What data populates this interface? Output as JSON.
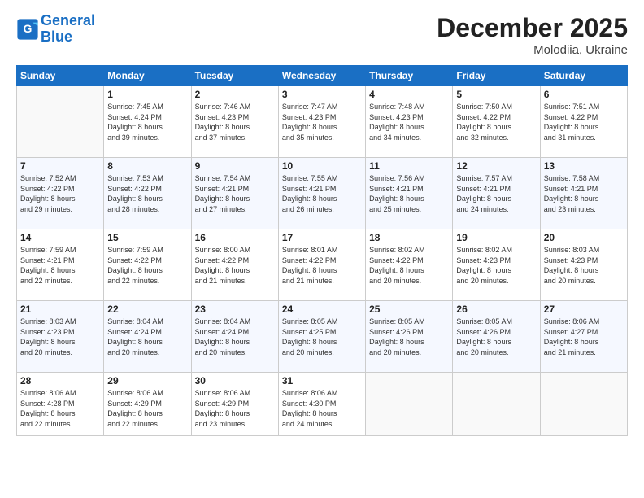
{
  "header": {
    "logo_line1": "General",
    "logo_line2": "Blue",
    "month": "December 2025",
    "location": "Molodiia, Ukraine"
  },
  "weekdays": [
    "Sunday",
    "Monday",
    "Tuesday",
    "Wednesday",
    "Thursday",
    "Friday",
    "Saturday"
  ],
  "weeks": [
    [
      {
        "day": "",
        "info": ""
      },
      {
        "day": "1",
        "info": "Sunrise: 7:45 AM\nSunset: 4:24 PM\nDaylight: 8 hours\nand 39 minutes."
      },
      {
        "day": "2",
        "info": "Sunrise: 7:46 AM\nSunset: 4:23 PM\nDaylight: 8 hours\nand 37 minutes."
      },
      {
        "day": "3",
        "info": "Sunrise: 7:47 AM\nSunset: 4:23 PM\nDaylight: 8 hours\nand 35 minutes."
      },
      {
        "day": "4",
        "info": "Sunrise: 7:48 AM\nSunset: 4:23 PM\nDaylight: 8 hours\nand 34 minutes."
      },
      {
        "day": "5",
        "info": "Sunrise: 7:50 AM\nSunset: 4:22 PM\nDaylight: 8 hours\nand 32 minutes."
      },
      {
        "day": "6",
        "info": "Sunrise: 7:51 AM\nSunset: 4:22 PM\nDaylight: 8 hours\nand 31 minutes."
      }
    ],
    [
      {
        "day": "7",
        "info": "Sunrise: 7:52 AM\nSunset: 4:22 PM\nDaylight: 8 hours\nand 29 minutes."
      },
      {
        "day": "8",
        "info": "Sunrise: 7:53 AM\nSunset: 4:22 PM\nDaylight: 8 hours\nand 28 minutes."
      },
      {
        "day": "9",
        "info": "Sunrise: 7:54 AM\nSunset: 4:21 PM\nDaylight: 8 hours\nand 27 minutes."
      },
      {
        "day": "10",
        "info": "Sunrise: 7:55 AM\nSunset: 4:21 PM\nDaylight: 8 hours\nand 26 minutes."
      },
      {
        "day": "11",
        "info": "Sunrise: 7:56 AM\nSunset: 4:21 PM\nDaylight: 8 hours\nand 25 minutes."
      },
      {
        "day": "12",
        "info": "Sunrise: 7:57 AM\nSunset: 4:21 PM\nDaylight: 8 hours\nand 24 minutes."
      },
      {
        "day": "13",
        "info": "Sunrise: 7:58 AM\nSunset: 4:21 PM\nDaylight: 8 hours\nand 23 minutes."
      }
    ],
    [
      {
        "day": "14",
        "info": "Sunrise: 7:59 AM\nSunset: 4:21 PM\nDaylight: 8 hours\nand 22 minutes."
      },
      {
        "day": "15",
        "info": "Sunrise: 7:59 AM\nSunset: 4:22 PM\nDaylight: 8 hours\nand 22 minutes."
      },
      {
        "day": "16",
        "info": "Sunrise: 8:00 AM\nSunset: 4:22 PM\nDaylight: 8 hours\nand 21 minutes."
      },
      {
        "day": "17",
        "info": "Sunrise: 8:01 AM\nSunset: 4:22 PM\nDaylight: 8 hours\nand 21 minutes."
      },
      {
        "day": "18",
        "info": "Sunrise: 8:02 AM\nSunset: 4:22 PM\nDaylight: 8 hours\nand 20 minutes."
      },
      {
        "day": "19",
        "info": "Sunrise: 8:02 AM\nSunset: 4:23 PM\nDaylight: 8 hours\nand 20 minutes."
      },
      {
        "day": "20",
        "info": "Sunrise: 8:03 AM\nSunset: 4:23 PM\nDaylight: 8 hours\nand 20 minutes."
      }
    ],
    [
      {
        "day": "21",
        "info": "Sunrise: 8:03 AM\nSunset: 4:23 PM\nDaylight: 8 hours\nand 20 minutes."
      },
      {
        "day": "22",
        "info": "Sunrise: 8:04 AM\nSunset: 4:24 PM\nDaylight: 8 hours\nand 20 minutes."
      },
      {
        "day": "23",
        "info": "Sunrise: 8:04 AM\nSunset: 4:24 PM\nDaylight: 8 hours\nand 20 minutes."
      },
      {
        "day": "24",
        "info": "Sunrise: 8:05 AM\nSunset: 4:25 PM\nDaylight: 8 hours\nand 20 minutes."
      },
      {
        "day": "25",
        "info": "Sunrise: 8:05 AM\nSunset: 4:26 PM\nDaylight: 8 hours\nand 20 minutes."
      },
      {
        "day": "26",
        "info": "Sunrise: 8:05 AM\nSunset: 4:26 PM\nDaylight: 8 hours\nand 20 minutes."
      },
      {
        "day": "27",
        "info": "Sunrise: 8:06 AM\nSunset: 4:27 PM\nDaylight: 8 hours\nand 21 minutes."
      }
    ],
    [
      {
        "day": "28",
        "info": "Sunrise: 8:06 AM\nSunset: 4:28 PM\nDaylight: 8 hours\nand 22 minutes."
      },
      {
        "day": "29",
        "info": "Sunrise: 8:06 AM\nSunset: 4:29 PM\nDaylight: 8 hours\nand 22 minutes."
      },
      {
        "day": "30",
        "info": "Sunrise: 8:06 AM\nSunset: 4:29 PM\nDaylight: 8 hours\nand 23 minutes."
      },
      {
        "day": "31",
        "info": "Sunrise: 8:06 AM\nSunset: 4:30 PM\nDaylight: 8 hours\nand 24 minutes."
      },
      {
        "day": "",
        "info": ""
      },
      {
        "day": "",
        "info": ""
      },
      {
        "day": "",
        "info": ""
      }
    ]
  ]
}
